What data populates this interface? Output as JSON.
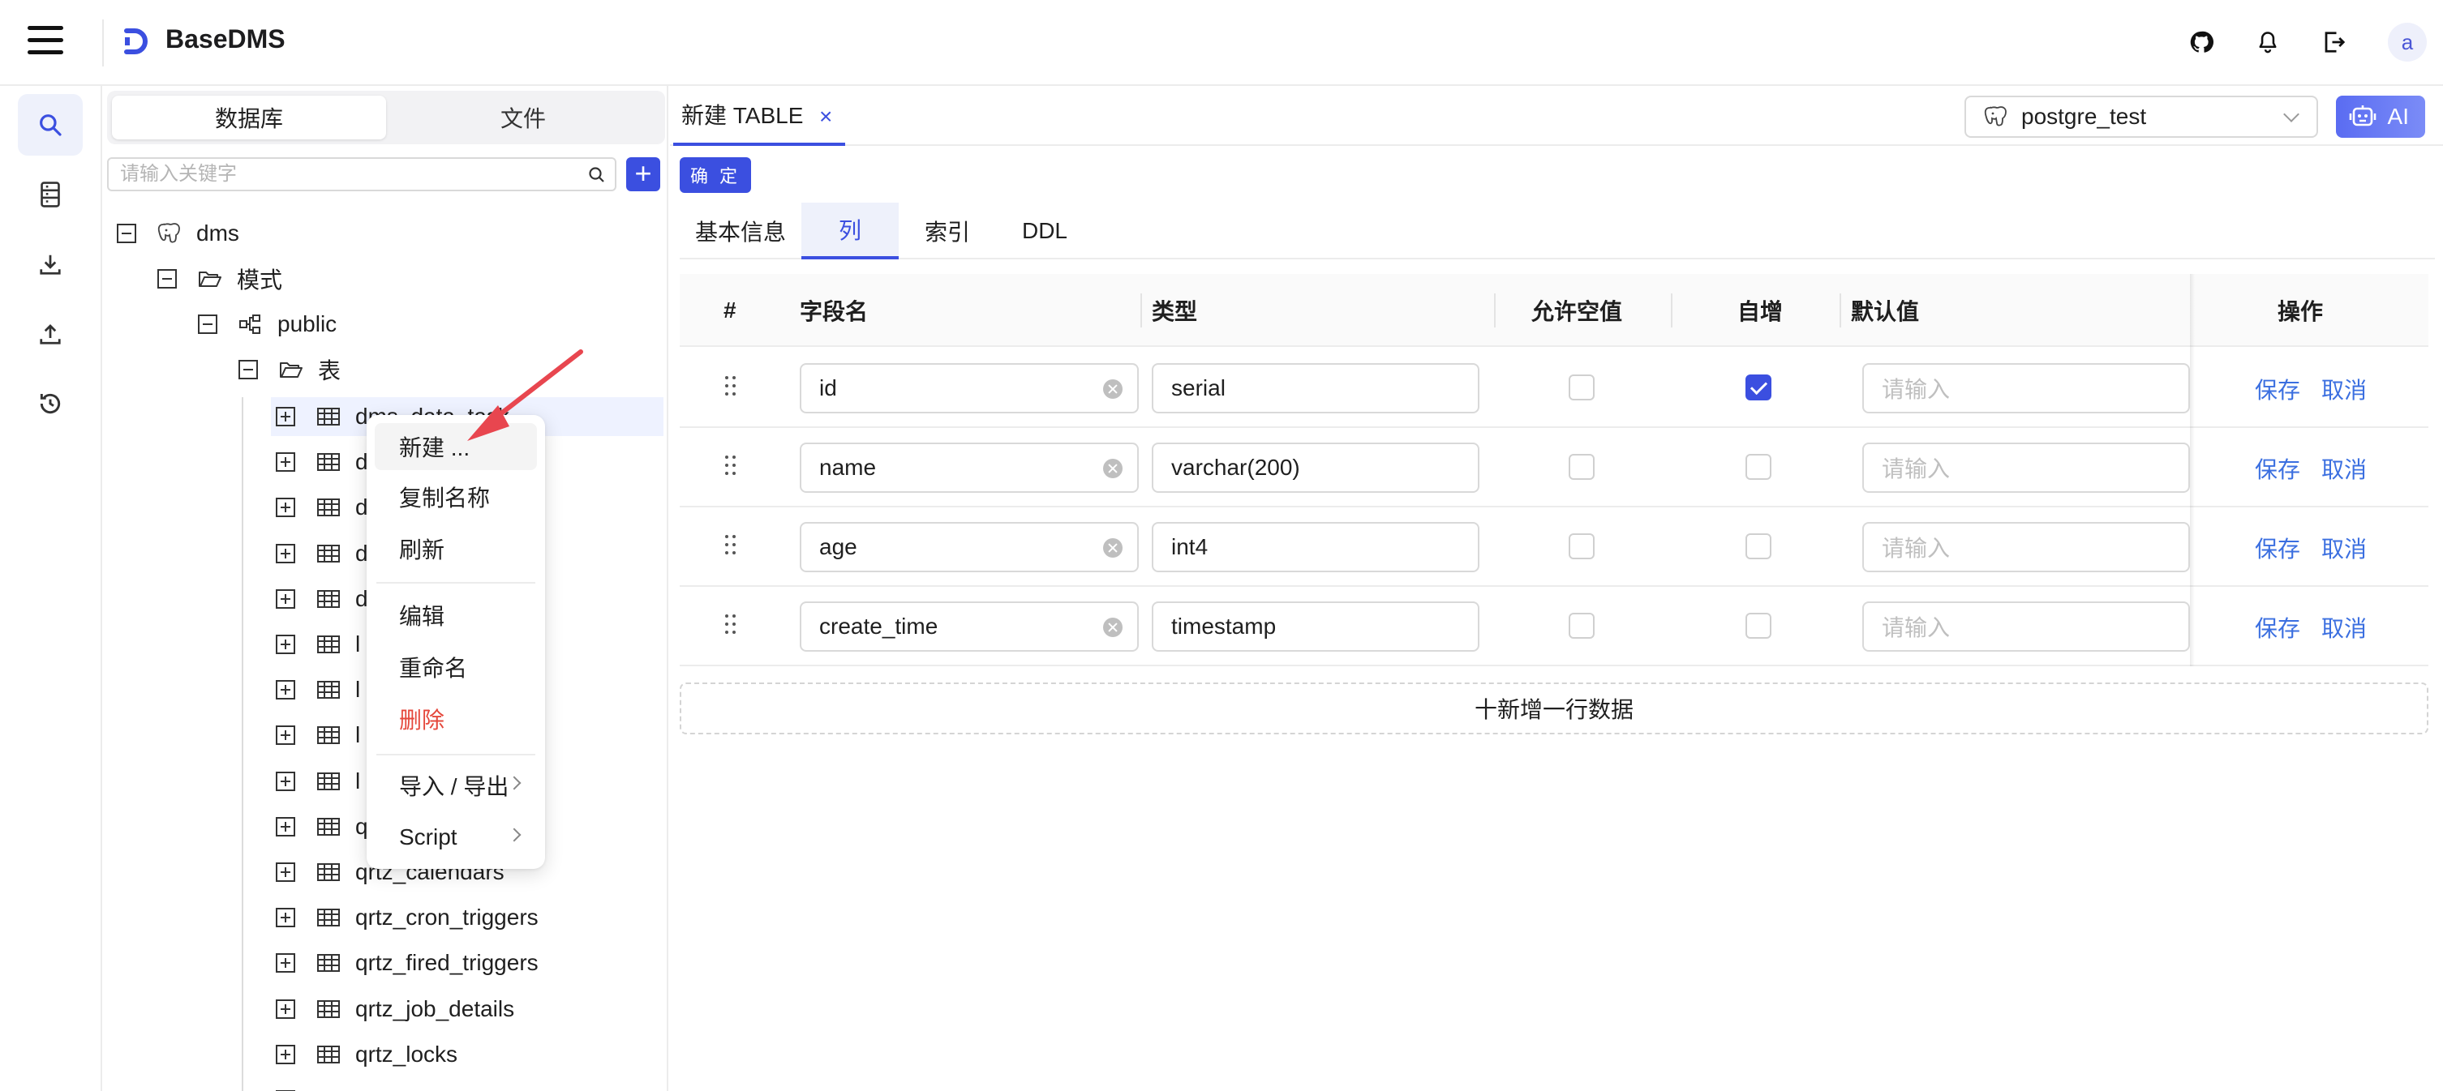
{
  "header": {
    "title": "BaseDMS",
    "avatar_letter": "a"
  },
  "rail": {
    "items": [
      "search-icon",
      "database-icon",
      "download-icon",
      "upload-icon",
      "history-icon"
    ]
  },
  "sidebar": {
    "tabs": [
      "数据库",
      "文件"
    ],
    "search": {
      "placeholder": "请输入关键字",
      "value": ""
    },
    "add_label": "+",
    "tree": {
      "db": "dms",
      "schemas_folder": "模式",
      "schema": "public",
      "tables_folder": "表",
      "tables": [
        "dms_data_task",
        "d",
        "d",
        "d",
        "d",
        "l",
        "l",
        "l",
        "l",
        "q                   s",
        "qrtz_calendars",
        "qrtz_cron_triggers",
        "qrtz_fired_triggers",
        "qrtz_job_details",
        "qrtz_locks",
        "qrtz_paused_trigger_grps"
      ]
    }
  },
  "context_menu": {
    "items": {
      "new": "新建 ...",
      "copy_name": "复制名称",
      "refresh": "刷新",
      "edit": "编辑",
      "rename": "重命名",
      "delete": "删除",
      "import_export": "导入 / 导出",
      "script": "Script"
    }
  },
  "main": {
    "tab_label": "新建 TABLE",
    "tab_close": "×",
    "connection": "postgre_test",
    "ai_label": "AI",
    "confirm_label": "确 定",
    "subtabs": [
      "基本信息",
      "列",
      "索引",
      "DDL"
    ],
    "active_subtab": "列",
    "columns_header": {
      "index": "#",
      "name": "字段名",
      "type": "类型",
      "nullable": "允许空值",
      "autoinc": "自增",
      "default": "默认值",
      "actions": "操作"
    },
    "rows": [
      {
        "name": "id",
        "type": "serial",
        "nullable": false,
        "autoinc": true,
        "default_placeholder": "请输入",
        "save": "保存",
        "cancel": "取消"
      },
      {
        "name": "name",
        "type": "varchar(200)",
        "nullable": false,
        "autoinc": false,
        "default_placeholder": "请输入",
        "save": "保存",
        "cancel": "取消"
      },
      {
        "name": "age",
        "type": "int4",
        "nullable": false,
        "autoinc": false,
        "default_placeholder": "请输入",
        "save": "保存",
        "cancel": "取消"
      },
      {
        "name": "create_time",
        "type": "timestamp",
        "nullable": false,
        "autoinc": false,
        "default_placeholder": "请输入",
        "save": "保存",
        "cancel": "取消"
      }
    ],
    "add_row_label": "十新增一行数据"
  },
  "colors": {
    "accent": "#3b4fe0",
    "link": "#3b6fe0",
    "danger": "#e5483c",
    "pointer": "#e8464f"
  }
}
